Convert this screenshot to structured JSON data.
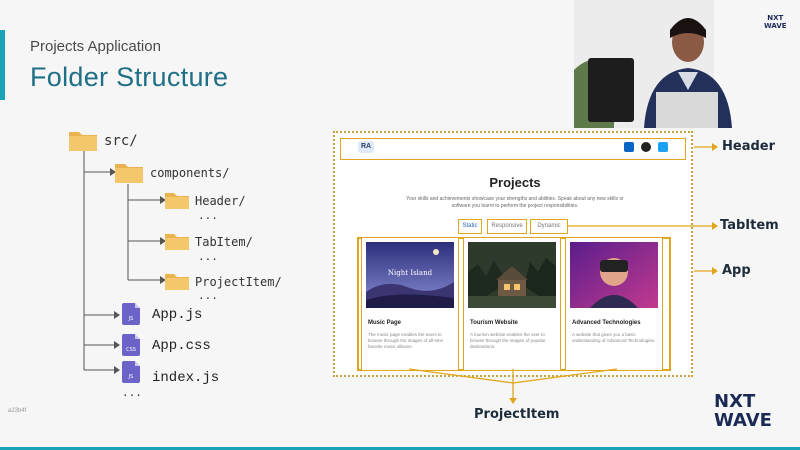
{
  "slide": {
    "subtitle": "Projects Application",
    "title": "Folder Structure",
    "watermark": "a23b4f"
  },
  "tree": {
    "root": "src/",
    "components": "components/",
    "header": "Header/",
    "tabitem": "TabItem/",
    "projectitem": "ProjectItem/",
    "ellipsis": "...",
    "files": [
      {
        "name": "App.js",
        "tag": "JS"
      },
      {
        "name": "App.css",
        "tag": "CSS"
      },
      {
        "name": "index.js",
        "tag": "JS"
      }
    ]
  },
  "mockup": {
    "ra": "RA",
    "heading": "Projects",
    "description": "Your skills and achievements showcase your strengths and abilities. Speak about any new skills or software you learnt to perform the project responsibilities.",
    "tabs": [
      "Static",
      "Responsive",
      "Dynamic"
    ],
    "cards": [
      {
        "title": "Music Page",
        "image_caption": "Night Island",
        "desc": "The music page enables the users to browse through the images of all-time favorite music albums."
      },
      {
        "title": "Tourism Website",
        "image_caption": "",
        "desc": "A tourism website enables the user to browse through the images of popular destinations."
      },
      {
        "title": "Advanced Technologies",
        "image_caption": "",
        "desc": "A website that gives you a basic understanding of Advanced Technologies."
      }
    ]
  },
  "callouts": {
    "header": "Header",
    "tabitem": "TabItem",
    "app": "App",
    "projectitem": "ProjectItem"
  },
  "brand": {
    "logo_line1": "NXT",
    "logo_line2": "WAVE"
  },
  "colors": {
    "accent": "#1aa3b6",
    "title": "#1f6f86",
    "highlight": "#e2a61c",
    "folder": "#f3c76a",
    "file": "#6c63c9"
  }
}
